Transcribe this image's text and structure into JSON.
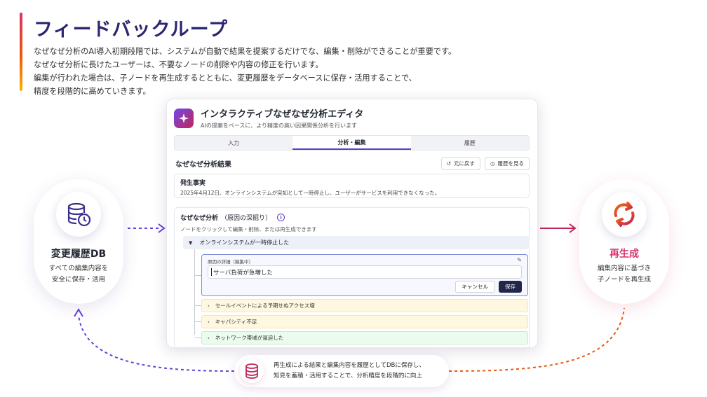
{
  "header": {
    "title": "フィードバックループ",
    "lines": [
      "なぜなぜ分析のAI導入初期段階では、システムが自動で結果を提案するだけでな、編集・削除ができることが重要です。",
      "なぜなぜ分析に長けたユーザーは、不要なノードの削除や内容の修正を行います。",
      "編集が行われた場合は、子ノードを再生成するとともに、変更履歴をデータベースに保存・活用することで、",
      "精度を段階的に高めていきます。"
    ]
  },
  "left_card": {
    "icon": "database-clock-icon",
    "title": "変更履歴DB",
    "desc1": "すべての編集内容を",
    "desc2": "安全に保存・活用"
  },
  "right_card": {
    "icon": "regenerate-cycle-icon",
    "title": "再生成",
    "desc1": "編集内容に基づき",
    "desc2": "子ノードを再生成"
  },
  "editor": {
    "title": "インタラクティブなぜなぜ分析エディタ",
    "subtitle": "AIの提案をベースに、より精度の高い因果関係分析を行います",
    "tabs": [
      {
        "label": "入力"
      },
      {
        "label": "分析・編集"
      },
      {
        "label": "履歴"
      }
    ],
    "active_tab": "分析・編集",
    "results_title": "なぜなぜ分析結果",
    "undo_label": "元に戻す",
    "history_label": "履歴を見る",
    "fact_heading": "発生事実",
    "fact_text": "2025年4月12日、オンラインシステムが突如として一時停止し、ユーザーがサービスを利用できなくなった。",
    "why_heading": "なぜなぜ分析",
    "why_heading_sub": "（原因の深掘り）",
    "why_note": "ノードをクリックして編集・削除、または再生成できます",
    "root_node": "オンラインシステムが一時停止した",
    "edit_label": "原因の詳細（編集中）",
    "edit_value": "サーバ負荷が急増した",
    "cancel_label": "キャンセル",
    "save_label": "保存",
    "children": [
      "セールイベントによる予期せぬアクセス増",
      "キャパシティ不足",
      "ネットワーク帯域が逼迫した"
    ]
  },
  "banner": {
    "icon": "database-icon",
    "line1": "再生成による結果と編集内容を履歴としてDBに保存し、",
    "line2": "知見を蓄積・活用することで、分析精度を段階的に向上"
  },
  "colors": {
    "accent_purple": "#5f3dc4",
    "accent_pink": "#d6336c",
    "title_navy": "#2b2670"
  }
}
